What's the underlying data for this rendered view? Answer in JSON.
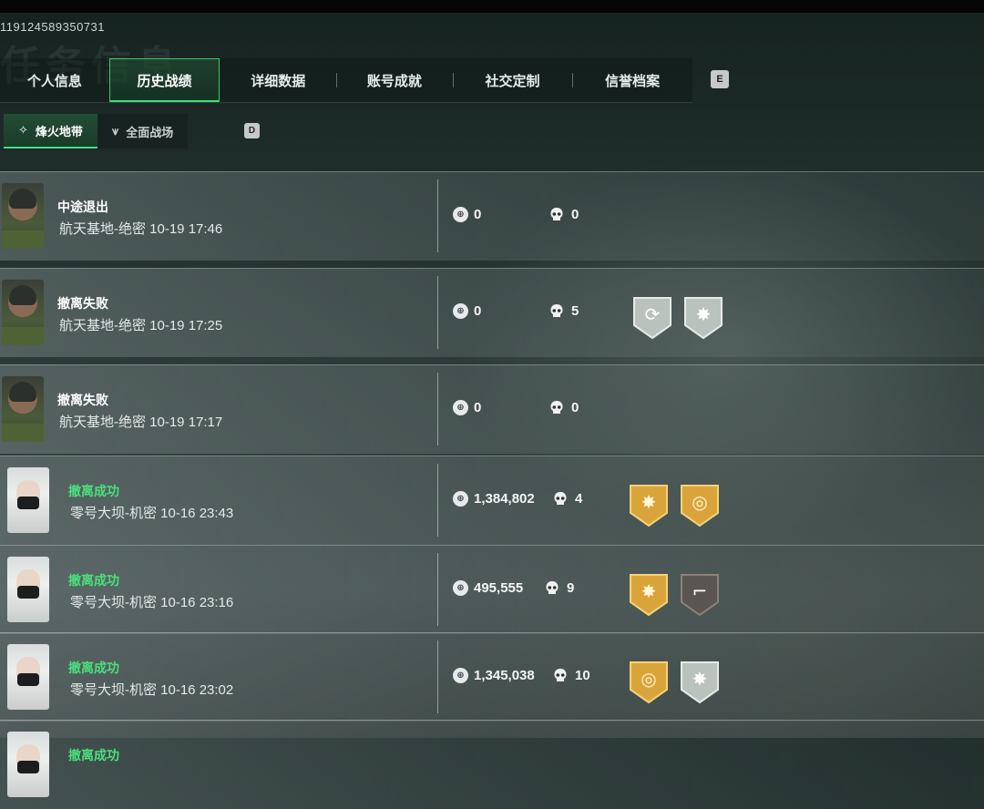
{
  "account_id": "119124589350731",
  "watermark_title": "任务信息",
  "tabs": [
    {
      "label": "个人信息",
      "active": false
    },
    {
      "label": "历史战绩",
      "active": true
    },
    {
      "label": "详细数据",
      "active": false
    },
    {
      "label": "账号成就",
      "active": false
    },
    {
      "label": "社交定制",
      "active": false
    },
    {
      "label": "信誉档案",
      "active": false
    }
  ],
  "tab_key_hint": "E",
  "modes": [
    {
      "label": "烽火地带",
      "icon": "crest-icon",
      "active": true
    },
    {
      "label": "全面战场",
      "icon": "wings-icon",
      "active": false
    }
  ],
  "mode_key_hint": "D",
  "colors": {
    "accent": "#3fe07a",
    "success": "#4be07c",
    "gold_badge": "#d9a53a",
    "grey_badge": "#b9c2bd"
  },
  "records": [
    {
      "status": "中途退出",
      "success": false,
      "map": "航天基地-绝密",
      "time": "10-19 17:46",
      "coins": "0",
      "kills": "0",
      "avatar": "female-dark",
      "badges": []
    },
    {
      "status": "撤离失败",
      "success": false,
      "map": "航天基地-绝密",
      "time": "10-19 17:25",
      "coins": "0",
      "kills": "5",
      "avatar": "female-dark",
      "badges": [
        {
          "icon": "cycle-icon",
          "tone": "grey"
        },
        {
          "icon": "burst-icon",
          "tone": "grey"
        }
      ]
    },
    {
      "status": "撤离失败",
      "success": false,
      "map": "航天基地-绝密",
      "time": "10-19 17:17",
      "coins": "0",
      "kills": "0",
      "avatar": "female-dark",
      "badges": []
    },
    {
      "status": "撤离成功",
      "success": true,
      "map": "零号大坝-机密",
      "time": "10-16 23:43",
      "coins": "1,384,802",
      "kills": "4",
      "avatar": "female-mask",
      "badges": [
        {
          "icon": "burst-icon",
          "tone": "gold"
        },
        {
          "icon": "coin-stack-icon",
          "tone": "gold"
        }
      ]
    },
    {
      "status": "撤离成功",
      "success": true,
      "map": "零号大坝-机密",
      "time": "10-16 23:16",
      "coins": "495,555",
      "kills": "9",
      "avatar": "female-mask",
      "badges": [
        {
          "icon": "burst-icon",
          "tone": "gold"
        },
        {
          "icon": "gun-icon",
          "tone": "dark"
        }
      ]
    },
    {
      "status": "撤离成功",
      "success": true,
      "map": "零号大坝-机密",
      "time": "10-16 23:02",
      "coins": "1,345,038",
      "kills": "10",
      "avatar": "female-mask",
      "badges": [
        {
          "icon": "coin-stack-icon",
          "tone": "gold"
        },
        {
          "icon": "burst-icon",
          "tone": "grey"
        }
      ]
    },
    {
      "status": "撤离成功",
      "success": true,
      "map": "",
      "time": "",
      "coins": "",
      "kills": "",
      "avatar": "female-mask",
      "badges": []
    }
  ]
}
